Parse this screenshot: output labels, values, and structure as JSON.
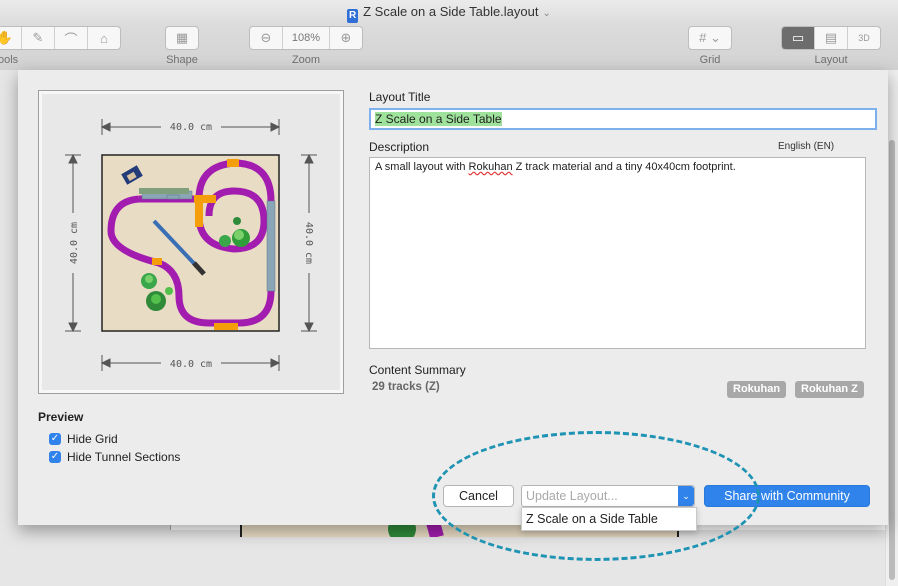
{
  "window": {
    "title": "Z Scale on a Side Table.layout"
  },
  "toolbar": {
    "tools_label": "ools",
    "shape_label": "Shape",
    "zoom_label": "Zoom",
    "zoom_value": "108%",
    "grid_label": "Grid",
    "layout_label": "Layout",
    "layout_3d": "3D"
  },
  "preview": {
    "dimension_top": "40.0 cm",
    "dimension_bottom": "40.0 cm",
    "dimension_left": "40.0 cm",
    "dimension_right": "40.0 cm"
  },
  "sheet": {
    "layout_title_label": "Layout Title",
    "layout_title_value": "Z Scale on a Side Table",
    "description_label": "Description",
    "language": "English (EN)",
    "description_value_1": "A small layout with ",
    "description_value_spell": "Rokuhan",
    "description_value_2": " Z track material and a tiny 40x40cm footprint.",
    "content_summary_label": "Content Summary",
    "content_summary_value": "29 tracks (Z)",
    "tags": [
      "Rokuhan",
      "Rokuhan Z"
    ],
    "preview_label": "Preview",
    "hide_grid_label": "Hide Grid",
    "hide_tunnel_label": "Hide Tunnel Sections",
    "cancel_label": "Cancel",
    "update_placeholder": "Update Layout...",
    "dropdown_item": "Z Scale on a Side Table",
    "share_label": "Share with Community"
  },
  "colors": {
    "accent": "#2f83ea",
    "annotation": "#1f93b3",
    "track": "#a21caf",
    "board": "#e9dcc4"
  }
}
